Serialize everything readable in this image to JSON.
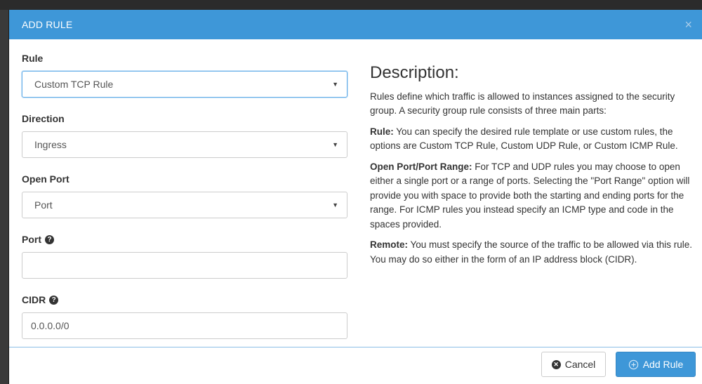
{
  "header": {
    "title": "ADD RULE",
    "close_glyph": "×"
  },
  "form": {
    "rule": {
      "label": "Rule",
      "value": "Custom TCP Rule"
    },
    "direction": {
      "label": "Direction",
      "value": "Ingress"
    },
    "open_port": {
      "label": "Open Port",
      "value": "Port"
    },
    "port": {
      "label": "Port",
      "value": ""
    },
    "cidr": {
      "label": "CIDR",
      "value": "0.0.0.0/0"
    },
    "help_glyph": "?",
    "caret_glyph": "▼"
  },
  "description": {
    "title": "Description:",
    "intro": "Rules define which traffic is allowed to instances assigned to the security group. A security group rule consists of three main parts:",
    "rule_heading": "Rule:",
    "rule_text": " You can specify the desired rule template or use custom rules, the options are Custom TCP Rule, Custom UDP Rule, or Custom ICMP Rule.",
    "port_heading": "Open Port/Port Range:",
    "port_text": " For TCP and UDP rules you may choose to open either a single port or a range of ports. Selecting the \"Port Range\" option will provide you with space to provide both the starting and ending ports for the range. For ICMP rules you instead specify an ICMP type and code in the spaces provided.",
    "remote_heading": "Remote:",
    "remote_text": " You must specify the source of the traffic to be allowed via this rule. You may do so either in the form of an IP address block (CIDR)."
  },
  "footer": {
    "cancel_label": "Cancel",
    "add_label": "Add Rule",
    "cancel_icon": "times-circle-icon",
    "add_icon": "plus-icon"
  },
  "colors": {
    "header": "#3e97d8",
    "primary_button": "#3e97d8",
    "focus_border": "#66afe9"
  }
}
